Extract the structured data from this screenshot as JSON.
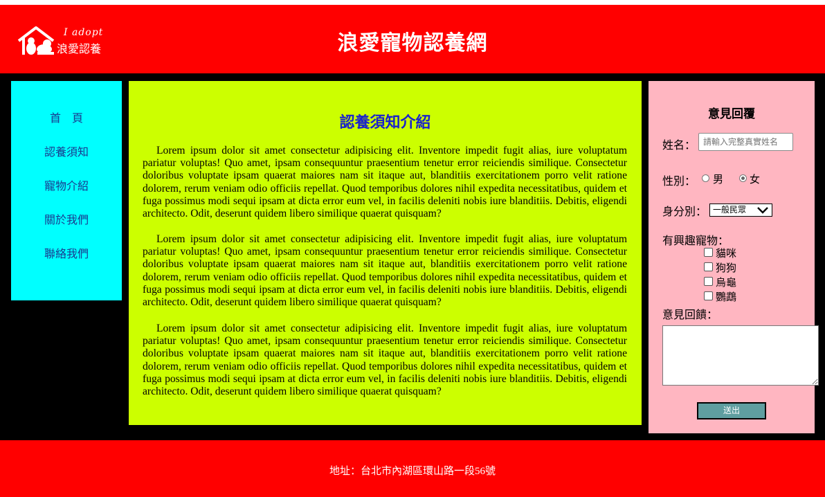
{
  "header": {
    "logo_tagline": "I adopt",
    "logo_name": "浪愛認養",
    "site_title": "浪愛寵物認養網"
  },
  "nav": {
    "items": [
      {
        "label": "首　頁"
      },
      {
        "label": "認養須知"
      },
      {
        "label": "寵物介紹"
      },
      {
        "label": "關於我們"
      },
      {
        "label": "聯絡我們"
      }
    ]
  },
  "main": {
    "title": "認養須知介紹",
    "paragraphs": [
      "Lorem ipsum dolor sit amet consectetur adipisicing elit. Inventore impedit fugit alias, iure voluptatum pariatur voluptas! Quo amet, ipsam consequuntur praesentium tenetur error reiciendis similique. Consectetur doloribus voluptate ipsam quaerat maiores nam sit itaque aut, blanditiis exercitationem porro velit ratione dolorem, rerum veniam odio officiis repellat. Quod temporibus dolores nihil expedita necessitatibus, quidem et fuga possimus modi sequi ipsam at dicta error eum vel, in facilis deleniti nobis iure blanditiis. Debitis, eligendi architecto. Odit, deserunt quidem libero similique quaerat quisquam?",
      "Lorem ipsum dolor sit amet consectetur adipisicing elit. Inventore impedit fugit alias, iure voluptatum pariatur voluptas! Quo amet, ipsam consequuntur praesentium tenetur error reiciendis similique. Consectetur doloribus voluptate ipsam quaerat maiores nam sit itaque aut, blanditiis exercitationem porro velit ratione dolorem, rerum veniam odio officiis repellat. Quod temporibus dolores nihil expedita necessitatibus, quidem et fuga possimus modi sequi ipsam at dicta error eum vel, in facilis deleniti nobis iure blanditiis. Debitis, eligendi architecto. Odit, deserunt quidem libero similique quaerat quisquam?",
      "Lorem ipsum dolor sit amet consectetur adipisicing elit. Inventore impedit fugit alias, iure voluptatum pariatur voluptas! Quo amet, ipsam consequuntur praesentium tenetur error reiciendis similique. Consectetur doloribus voluptate ipsam quaerat maiores nam sit itaque aut, blanditiis exercitationem porro velit ratione dolorem, rerum veniam odio officiis repellat. Quod temporibus dolores nihil expedita necessitatibus, quidem et fuga possimus modi sequi ipsam at dicta error eum vel, in facilis deleniti nobis iure blanditiis. Debitis, eligendi architecto. Odit, deserunt quidem libero similique quaerat quisquam?"
    ]
  },
  "feedback": {
    "title": "意見回覆",
    "name_label": "姓名：",
    "name_placeholder": "請輸入完整真實姓名",
    "gender_label": "性別：",
    "gender_options": [
      {
        "label": "男",
        "selected": false
      },
      {
        "label": "女",
        "selected": true
      }
    ],
    "identity_label": "身分別：",
    "identity_selected": "一般民眾",
    "pets_label": "有興趣寵物：",
    "pets": [
      {
        "label": "貓咪",
        "checked": false
      },
      {
        "label": "狗狗",
        "checked": false
      },
      {
        "label": "烏龜",
        "checked": false
      },
      {
        "label": "鸚鵡",
        "checked": false
      }
    ],
    "comment_label": "意見回饋：",
    "comment_value": "",
    "submit_label": "送出"
  },
  "footer": {
    "address": "地址：台北市內湖區環山路一段56號"
  },
  "colors": {
    "header_bg": "#ff0000",
    "nav_bg": "#00ffff",
    "main_bg": "#ccff00",
    "aside_bg": "#ffb6c1",
    "submit_bg": "#5f9ea0",
    "title_blue": "#1a22cc"
  }
}
